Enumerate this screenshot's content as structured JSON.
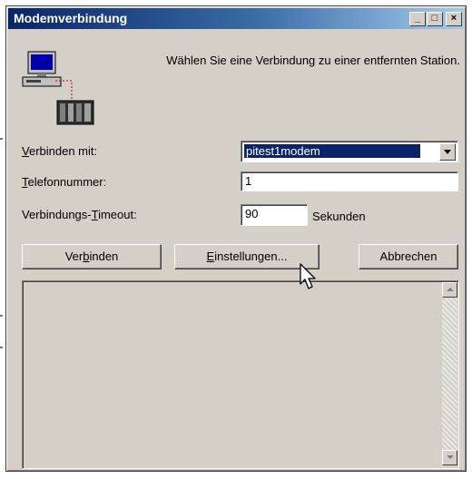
{
  "window": {
    "title": "Modemverbindung"
  },
  "titlebar_buttons": {
    "minimize": "_",
    "maximize": "□",
    "close": "×"
  },
  "instruction": "Wählen Sie eine Verbindung zu einer entfernten Station.",
  "connect_with": {
    "label_key": "V",
    "label_rest": "erbinden mit:",
    "value": "pitest1modem"
  },
  "phone": {
    "label_key": "T",
    "label_rest": "elefonnummer:",
    "value": "1"
  },
  "timeout": {
    "label_pre": "Verbindungs-",
    "label_key": "T",
    "label_rest": "imeout:",
    "value": "90",
    "unit": "Sekunden"
  },
  "buttons": {
    "connect_pre": "Ver",
    "connect_key": "b",
    "connect_rest": "inden",
    "settings_key": "E",
    "settings_rest": "instellungen...",
    "cancel": "Abbrechen"
  },
  "colors": {
    "title_bar": "#0a246a",
    "window_face": "#d4d0c8",
    "selection": "#0a246a"
  },
  "icons": {
    "station": "computer-modem-plc-icon",
    "cursor": "mouse-pointer-icon"
  }
}
